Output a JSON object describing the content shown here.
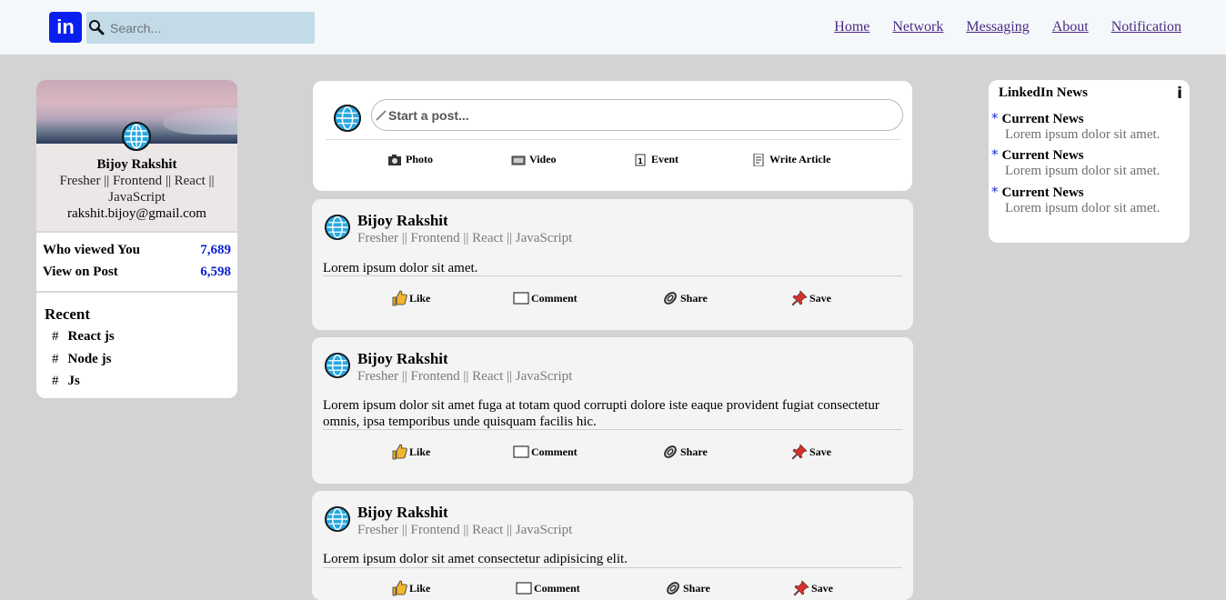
{
  "header": {
    "logo": "in",
    "search_placeholder": "Search...",
    "nav": [
      "Home",
      "Network",
      "Messaging",
      "About",
      "Notification"
    ]
  },
  "profile": {
    "name": "Bijoy Rakshit",
    "title": "Fresher || Frontend || React || JavaScript",
    "email": "rakshit.bijoy@gmail.com",
    "stats": [
      {
        "label": "Who viewed You",
        "value": "7,689"
      },
      {
        "label": "View on Post",
        "value": "6,598"
      }
    ],
    "recent_title": "Recent",
    "recent": [
      {
        "hash": "#",
        "label": "React js"
      },
      {
        "hash": "#",
        "label": "Node js"
      },
      {
        "hash": "#",
        "label": "Js"
      }
    ]
  },
  "composer": {
    "placeholder": "Start a post...",
    "actions": [
      "Photo",
      "Video",
      "Event",
      "Write Article"
    ]
  },
  "posts": [
    {
      "author": "Bijoy Rakshit",
      "subtitle": "Fresher || Frontend || React || JavaScript",
      "text": "Lorem ipsum dolor sit amet."
    },
    {
      "author": "Bijoy Rakshit",
      "subtitle": "Fresher || Frontend || React || JavaScript",
      "text": "Lorem ipsum dolor sit amet fuga at totam quod corrupti dolore iste eaque provident fugiat consectetur omnis, ipsa temporibus unde quisquam facilis hic."
    },
    {
      "author": "Bijoy Rakshit",
      "subtitle": "Fresher || Frontend || React || JavaScript",
      "text": "Lorem ipsum dolor sit amet consectetur adipisicing elit."
    }
  ],
  "post_actions": [
    "Like",
    "Comment",
    "Share",
    "Save"
  ],
  "news": {
    "title": "LinkedIn News",
    "info": "i",
    "items": [
      {
        "heading": "Current News",
        "desc": "Lorem ipsum dolor sit amet."
      },
      {
        "heading": "Current News",
        "desc": "Lorem ipsum dolor sit amet."
      },
      {
        "heading": "Current News",
        "desc": "Lorem ipsum dolor sit amet."
      }
    ]
  },
  "colors": {
    "accent": "#0a1ef0",
    "stat_number": "#0a1ecf",
    "link": "#4b2a86",
    "background": "#d3d3d3"
  }
}
